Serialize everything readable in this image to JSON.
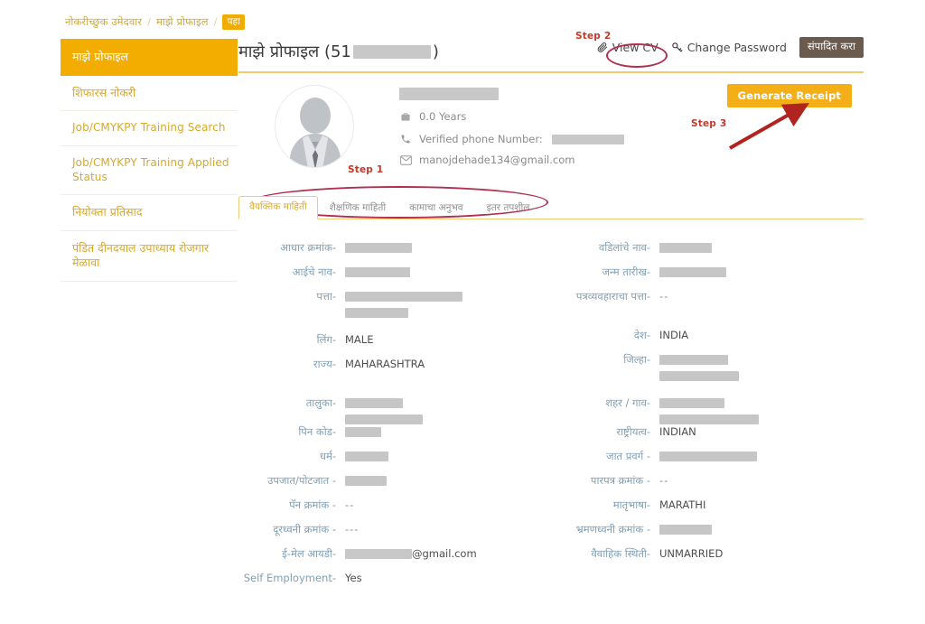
{
  "breadcrumb": {
    "items": [
      {
        "label": "नोकरीच्छुक उमेदवार",
        "current": false
      },
      {
        "label": "माझे प्रोफाइल",
        "current": false
      },
      {
        "label": "पहा",
        "current": true
      }
    ],
    "separator": "/"
  },
  "sidebar": {
    "items": [
      {
        "label": "माझे प्रोफाइल",
        "active": true
      },
      {
        "label": "शिफारस नोकरी",
        "active": false
      },
      {
        "label": "Job/CMYKPY Training Search",
        "active": false
      },
      {
        "label": "Job/CMYKPY Training Applied Status",
        "active": false
      },
      {
        "label": "नियोक्ता प्रतिसाद",
        "active": false
      },
      {
        "label": "पंडित दीनदयाल उपाध्याय रोजगार मेळावा",
        "active": false
      }
    ]
  },
  "header": {
    "title_prefix": "माझे प्रोफाइल (51",
    "title_suffix": ")",
    "view_cv_label": "View CV",
    "change_password_label": "Change Password",
    "edit_button_label": "संपादित करा"
  },
  "profile": {
    "experience": "0.0 Years",
    "phone_label": "Verified phone Number:",
    "email": "manojdehade134@gmail.com",
    "generate_receipt_label": "Generate Receipt"
  },
  "tabs": [
    {
      "label": "वैयक्तिक माहिती",
      "active": true
    },
    {
      "label": "शैक्षणिक माहिती",
      "active": false
    },
    {
      "label": "कामाचा अनुभव",
      "active": false
    },
    {
      "label": "इतर तपशील",
      "active": false
    }
  ],
  "form": {
    "left": [
      {
        "label": "आधार क्रमांक-",
        "value": "",
        "redacted": [
          74
        ]
      },
      {
        "label": "आईचे नाव-",
        "value": "",
        "redacted": [
          72
        ]
      },
      {
        "label": "पत्ता-",
        "value": "",
        "redacted": [
          130,
          70
        ]
      },
      {
        "label": "",
        "value": "",
        "spacer": true
      },
      {
        "label": "लिंग-",
        "value": "MALE",
        "redacted": []
      },
      {
        "label": "राज्य-",
        "value": "MAHARASHTRA",
        "redacted": []
      },
      {
        "label": "",
        "value": "",
        "spacer": true
      },
      {
        "label": "तालुका-",
        "value": "",
        "redacted": [
          64,
          86
        ]
      },
      {
        "label": "पिन कोड-",
        "value": "",
        "redacted": [
          40
        ]
      },
      {
        "label": "धर्म-",
        "value": "",
        "redacted": [
          48
        ]
      },
      {
        "label": "उपजात/पोटजात -",
        "value": "",
        "redacted": [
          46
        ]
      },
      {
        "label": "पॅन क्रमांक -",
        "value": "--",
        "redacted": []
      },
      {
        "label": "दूरध्वनी क्रमांक -",
        "value": "---",
        "redacted": []
      },
      {
        "label": "ई-मेल आयडी-",
        "value": "@gmail.com",
        "redacted": [
          74
        ],
        "inline_redact": true
      },
      {
        "label": "Self Employment-",
        "value": "Yes",
        "redacted": []
      }
    ],
    "right": [
      {
        "label": "वडिलांचे नाव-",
        "value": "",
        "redacted": [
          58
        ]
      },
      {
        "label": "जन्म तारीख-",
        "value": "",
        "redacted": [
          74
        ]
      },
      {
        "label": "पत्रव्यवहाराचा पत्ता-",
        "value": "--",
        "redacted": []
      },
      {
        "label": "",
        "value": "",
        "spacer": true
      },
      {
        "label": "देश-",
        "value": "INDIA",
        "redacted": []
      },
      {
        "label": "जिल्हा-",
        "value": "",
        "redacted": [
          76,
          88
        ]
      },
      {
        "label": "",
        "value": "",
        "spacer": true
      },
      {
        "label": "शहर / गाव-",
        "value": "",
        "redacted": [
          72,
          110
        ]
      },
      {
        "label": "राष्ट्रीयत्व-",
        "value": "INDIAN",
        "redacted": []
      },
      {
        "label": "जात प्रवर्ग -",
        "value": "",
        "redacted": [
          108
        ]
      },
      {
        "label": "पारपत्र क्रमांक -",
        "value": "--",
        "redacted": []
      },
      {
        "label": "मातृभाषा-",
        "value": "MARATHI",
        "redacted": []
      },
      {
        "label": "भ्रमणध्वनी क्रमांक -",
        "value": "",
        "redacted": [
          58
        ]
      },
      {
        "label": "वैवाहिक स्थिती-",
        "value": "UNMARRIED",
        "redacted": []
      }
    ]
  },
  "annotations": [
    {
      "id": "step1",
      "label": "Step 1"
    },
    {
      "id": "step2",
      "label": "Step 2"
    },
    {
      "id": "step3",
      "label": "Step 3"
    }
  ],
  "colors": {
    "accent_gold": "#f2ad00",
    "sidebar_text": "#d9a82b",
    "label_blue": "#7f9fb5",
    "annotation_red": "#c0392b",
    "edit_button": "#6b5a4e",
    "receipt_button": "#f4af18"
  }
}
